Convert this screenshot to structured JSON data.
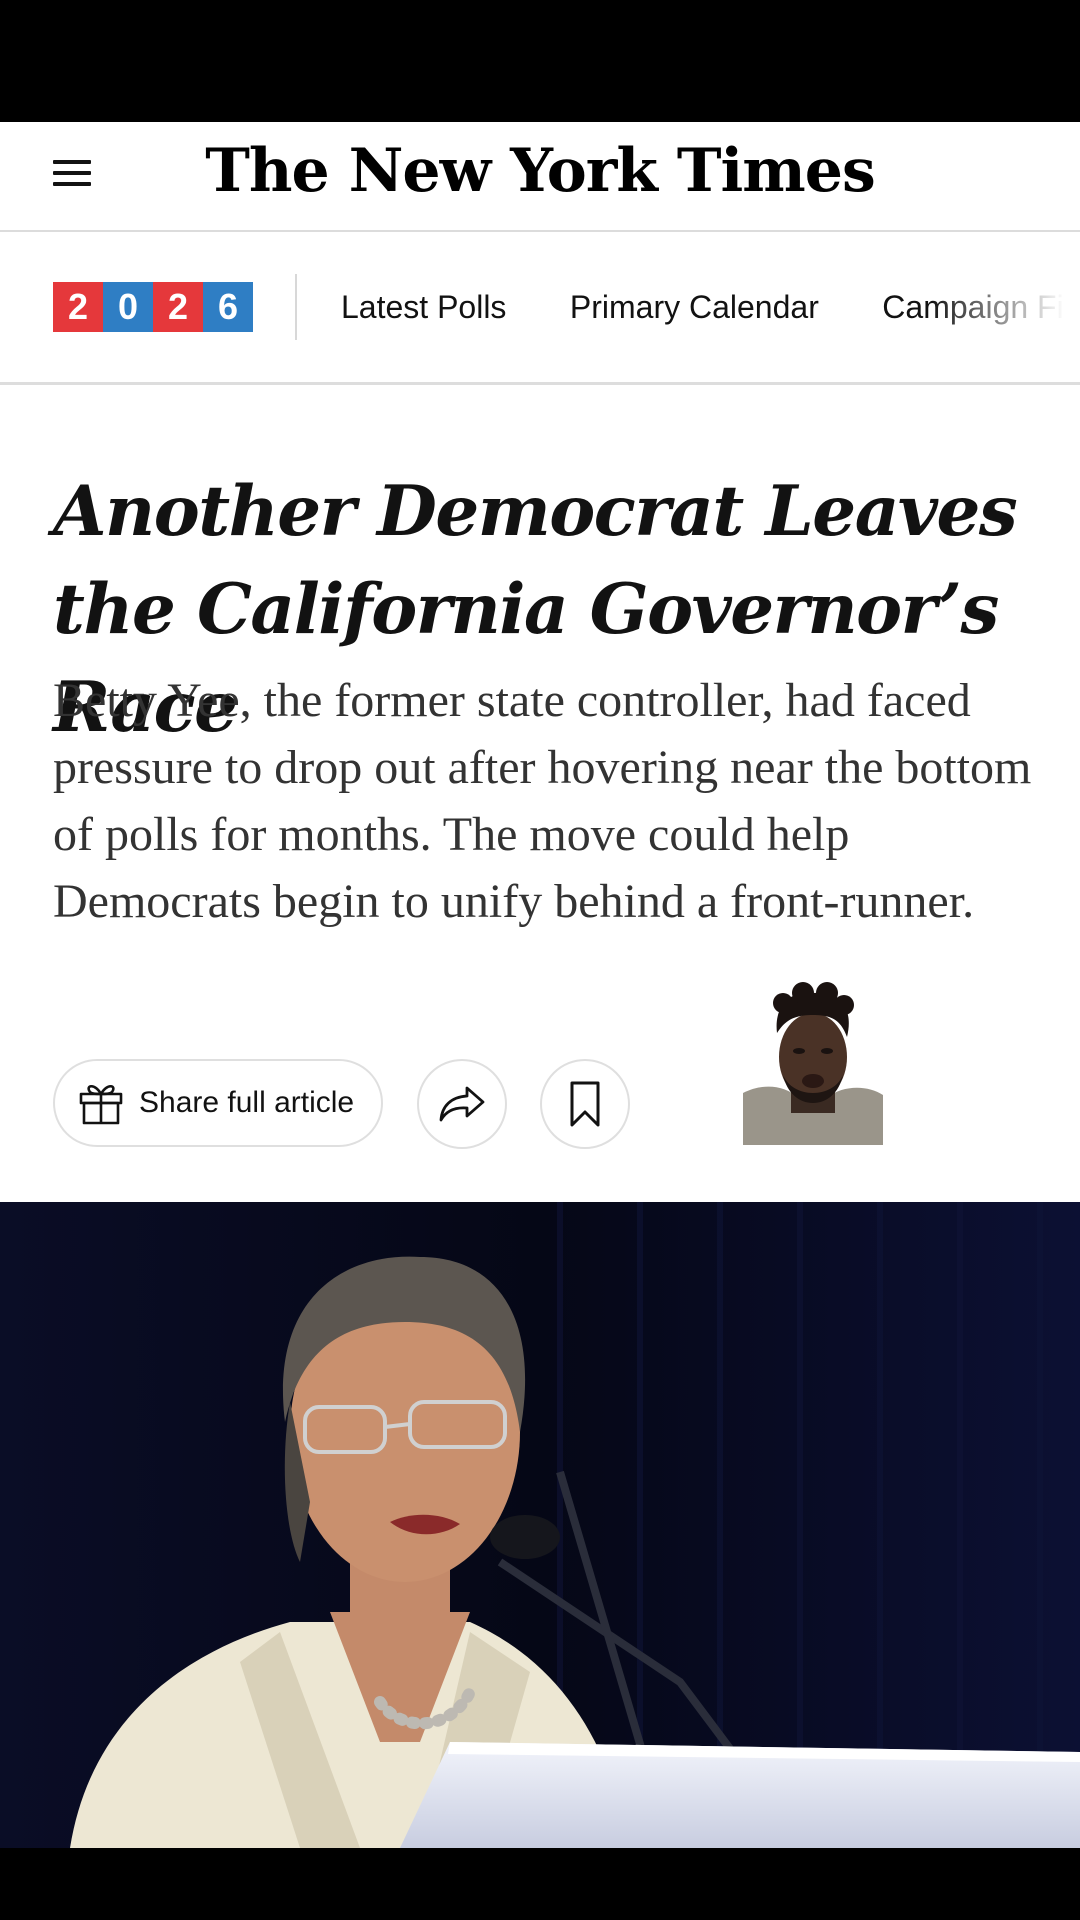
{
  "masthead": {
    "logo_text": "The New York Times",
    "menu_icon": "hamburger-menu-icon"
  },
  "subnav": {
    "badge": {
      "digits": [
        "2",
        "0",
        "2",
        "6"
      ],
      "colors": [
        "#e5383b",
        "#2f7ec4",
        "#e5383b",
        "#2f7ec4"
      ]
    },
    "links": [
      "Latest Polls",
      "Primary Calendar",
      "Campaign Fi"
    ]
  },
  "article": {
    "headline": "Another Democrat Leaves the California Governor’s Race",
    "summary": "Betty Yee, the former state controller, had faced pressure to drop out after hovering near the bottom of polls for months. The move could help Democrats begin to unify behind a front-runner.",
    "share_label": "Share full article",
    "share_icon": "gift-icon",
    "forward_icon": "share-arrow-icon",
    "bookmark_icon": "bookmark-icon"
  },
  "colors": {
    "text": "#121212",
    "summary_text": "#333333",
    "photo_background": "#070a22"
  }
}
